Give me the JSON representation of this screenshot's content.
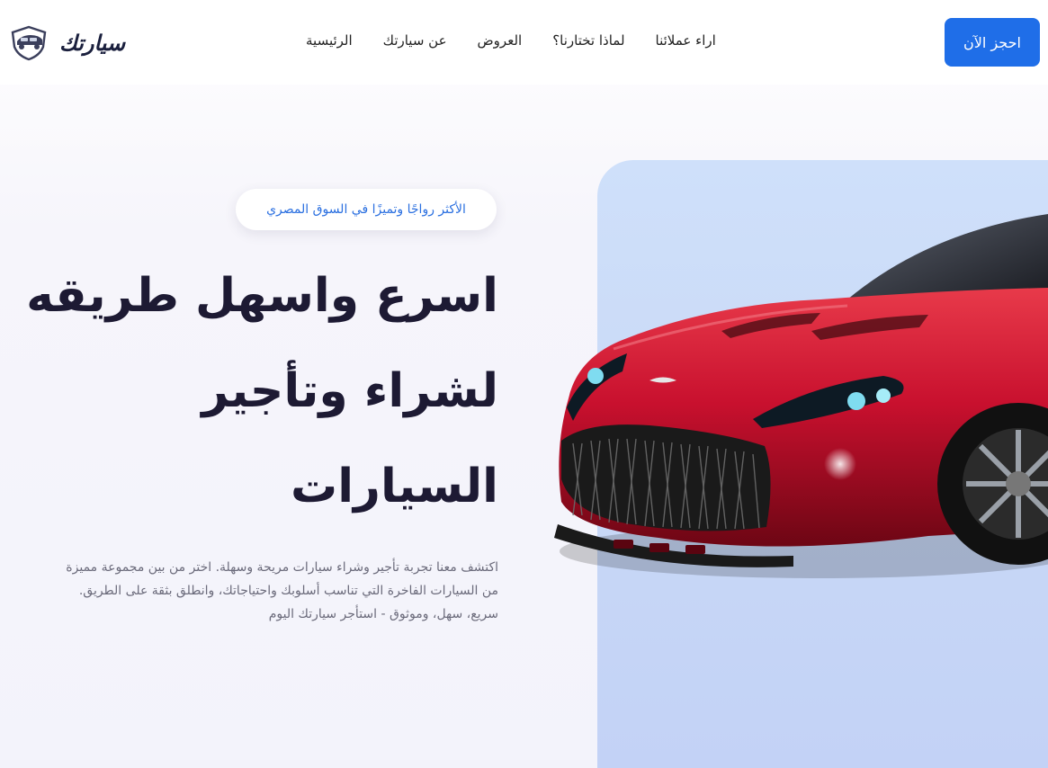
{
  "header": {
    "cta_label": "احجز الآن",
    "brand_name": "سيارتك",
    "nav": [
      {
        "label": "الرئيسية"
      },
      {
        "label": "عن سيارتك"
      },
      {
        "label": "العروض"
      },
      {
        "label": "لماذا تختارنا؟"
      },
      {
        "label": "اراء عملائنا"
      }
    ]
  },
  "hero": {
    "badge": "الأكثر رواجًا وتميزًا في السوق المصري",
    "headline_lines": [
      "اسرع واسهل طريقه",
      "لشراء وتأجير",
      "السيارات"
    ],
    "description_lines": [
      "اكتشف معنا تجربة تأجير وشراء سيارات مريحة وسهلة. اختر من بين مجموعة مميزة",
      "من السيارات الفاخرة التي تناسب أسلوبك واحتياجاتك، وانطلق بثقة على الطريق.",
      "سريع، سهل، وموثوق - استأجر سيارتك اليوم"
    ]
  },
  "colors": {
    "accent": "#1f6ee8",
    "heading": "#1d1a33",
    "panel": "#cfe0fa",
    "car": "#c8102e"
  },
  "icons": {
    "logo": "car-shield-icon"
  }
}
